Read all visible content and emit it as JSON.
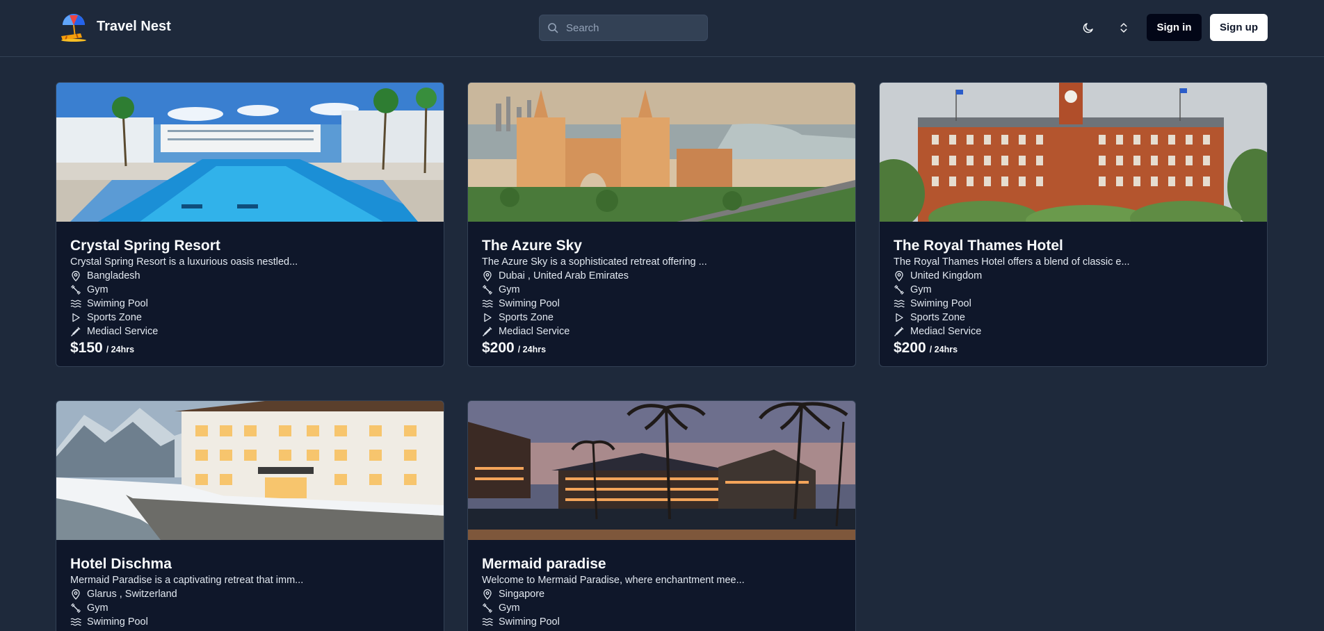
{
  "header": {
    "brand": "Travel Nest",
    "search_placeholder": "Search",
    "signin_label": "Sign in",
    "signup_label": "Sign up",
    "icons": [
      "umbrella-beach-logo",
      "search-icon",
      "moon-icon",
      "chevrons-up-down-icon"
    ]
  },
  "colors": {
    "page_background": "#1e293b",
    "card_background": "#0f172a",
    "signin_button": "#020617",
    "signup_button": "#ffffff"
  },
  "hotels": [
    {
      "name": "Crystal Spring Resort",
      "description": "Crystal Spring Resort is a luxurious oasis nestled...",
      "location": "Bangladesh",
      "features": [
        "Gym",
        "Swiming Pool",
        "Sports Zone",
        "Mediacl Service"
      ],
      "price": "$150",
      "per": "/ 24hrs",
      "photo": "resort pool with palm trees"
    },
    {
      "name": "The Azure Sky",
      "description": "The Azure Sky is a sophisticated retreat offering ...",
      "location": "Dubai , United Arab Emirates",
      "features": [
        "Gym",
        "Swiming Pool",
        "Sports Zone",
        "Mediacl Service"
      ],
      "price": "$200",
      "per": "/ 24hrs",
      "photo": "arched palace resort by the sea"
    },
    {
      "name": "The Royal Thames Hotel",
      "description": "The Royal Thames Hotel offers a blend of classic e...",
      "location": "United Kingdom",
      "features": [
        "Gym",
        "Swiming Pool",
        "Sports Zone",
        "Mediacl Service"
      ],
      "price": "$200",
      "per": "/ 24hrs",
      "photo": "red brick victorian hotel with clock tower"
    },
    {
      "name": "Hotel Dischma",
      "description": "Mermaid Paradise is a captivating retreat that imm...",
      "location": "Glarus , Switzerland",
      "features": [
        "Gym",
        "Swiming Pool"
      ],
      "photo": "alpine hotel in snow"
    },
    {
      "name": "Mermaid paradise",
      "description": "Welcome to Mermaid Paradise, where enchantment mee...",
      "location": "Singapore",
      "features": [
        "Gym",
        "Swiming Pool"
      ],
      "photo": "tropical resort at dusk with palms"
    }
  ]
}
